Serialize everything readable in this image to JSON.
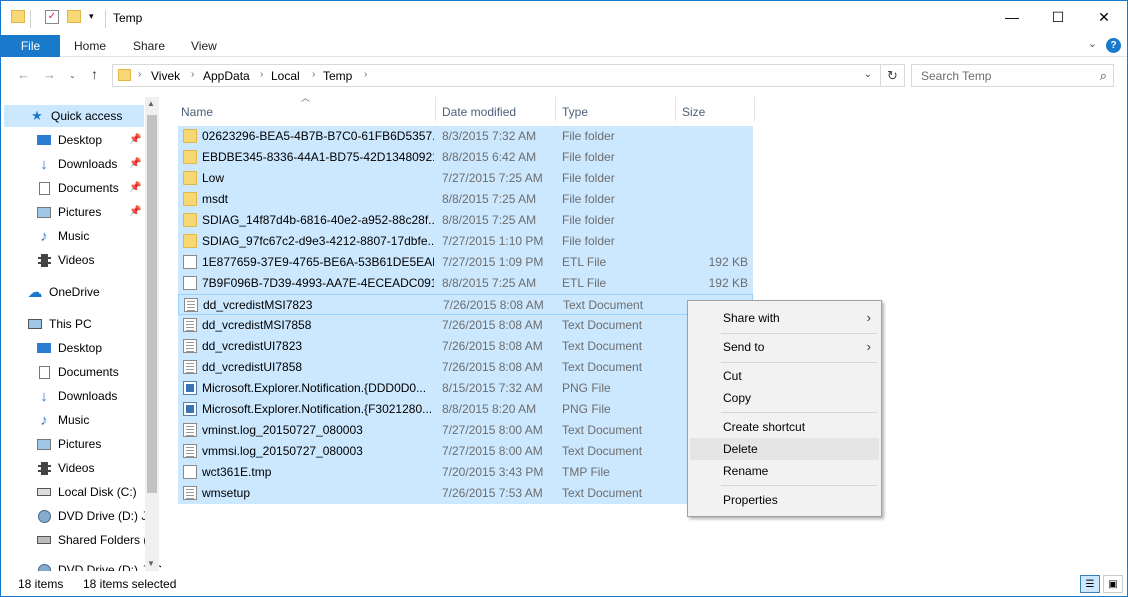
{
  "window": {
    "title": "Temp",
    "controls": {
      "minimize": "—",
      "maximize": "☐",
      "close": "✕"
    }
  },
  "ribbon": {
    "file": "File",
    "tabs": [
      "Home",
      "Share",
      "View"
    ]
  },
  "address": {
    "crumbs": [
      "Vivek",
      "AppData",
      "Local",
      "Temp"
    ],
    "search_placeholder": "Search Temp"
  },
  "nav": {
    "quick_access": "Quick access",
    "quick_items": [
      "Desktop",
      "Downloads",
      "Documents",
      "Pictures",
      "Music",
      "Videos"
    ],
    "onedrive": "OneDrive",
    "this_pc": "This PC",
    "pc_items": [
      "Desktop",
      "Documents",
      "Downloads",
      "Music",
      "Pictures",
      "Videos",
      "Local Disk (C:)",
      "DVD Drive (D:) J_",
      "Shared Folders (\\",
      "DVD Drive (D:) J_C"
    ]
  },
  "columns": {
    "name": "Name",
    "date": "Date modified",
    "type": "Type",
    "size": "Size"
  },
  "files": [
    {
      "name": "02623296-BEA5-4B7B-B7C0-61FB6D5357...",
      "date": "8/3/2015 7:32 AM",
      "type": "File folder",
      "size": "",
      "icon": "folder"
    },
    {
      "name": "EBDBE345-8336-44A1-BD75-42D134809216",
      "date": "8/8/2015 6:42 AM",
      "type": "File folder",
      "size": "",
      "icon": "folder"
    },
    {
      "name": "Low",
      "date": "7/27/2015 7:25 AM",
      "type": "File folder",
      "size": "",
      "icon": "folder"
    },
    {
      "name": "msdt",
      "date": "8/8/2015 7:25 AM",
      "type": "File folder",
      "size": "",
      "icon": "folder"
    },
    {
      "name": "SDIAG_14f87d4b-6816-40e2-a952-88c28f...",
      "date": "8/8/2015 7:25 AM",
      "type": "File folder",
      "size": "",
      "icon": "folder"
    },
    {
      "name": "SDIAG_97fc67c2-d9e3-4212-8807-17dbfe...",
      "date": "7/27/2015 1:10 PM",
      "type": "File folder",
      "size": "",
      "icon": "folder"
    },
    {
      "name": "1E877659-37E9-4765-BE6A-53B61DE5EAB...",
      "date": "7/27/2015 1:09 PM",
      "type": "ETL File",
      "size": "192 KB",
      "icon": "file"
    },
    {
      "name": "7B9F096B-7D39-4993-AA7E-4ECEADC091...",
      "date": "8/8/2015 7:25 AM",
      "type": "ETL File",
      "size": "192 KB",
      "icon": "file"
    },
    {
      "name": "dd_vcredistMSI7823",
      "date": "7/26/2015 8:08 AM",
      "type": "Text Document",
      "size": "",
      "icon": "text"
    },
    {
      "name": "dd_vcredistMSI7858",
      "date": "7/26/2015 8:08 AM",
      "type": "Text Document",
      "size": "",
      "icon": "text"
    },
    {
      "name": "dd_vcredistUI7823",
      "date": "7/26/2015 8:08 AM",
      "type": "Text Document",
      "size": "",
      "icon": "text"
    },
    {
      "name": "dd_vcredistUI7858",
      "date": "7/26/2015 8:08 AM",
      "type": "Text Document",
      "size": "",
      "icon": "text"
    },
    {
      "name": "Microsoft.Explorer.Notification.{DDD0D0...",
      "date": "8/15/2015 7:32 AM",
      "type": "PNG File",
      "size": "",
      "icon": "png"
    },
    {
      "name": "Microsoft.Explorer.Notification.{F3021280...",
      "date": "8/8/2015 8:20 AM",
      "type": "PNG File",
      "size": "",
      "icon": "png"
    },
    {
      "name": "vminst.log_20150727_080003",
      "date": "7/27/2015 8:00 AM",
      "type": "Text Document",
      "size": "",
      "icon": "text"
    },
    {
      "name": "vmmsi.log_20150727_080003",
      "date": "7/27/2015 8:00 AM",
      "type": "Text Document",
      "size": "",
      "icon": "text"
    },
    {
      "name": "wct361E.tmp",
      "date": "7/20/2015 3:43 PM",
      "type": "TMP File",
      "size": "",
      "icon": "file"
    },
    {
      "name": "wmsetup",
      "date": "7/26/2015 7:53 AM",
      "type": "Text Document",
      "size": "",
      "icon": "text"
    }
  ],
  "context_menu": {
    "share_with": "Share with",
    "send_to": "Send to",
    "cut": "Cut",
    "copy": "Copy",
    "create_shortcut": "Create shortcut",
    "delete": "Delete",
    "rename": "Rename",
    "properties": "Properties"
  },
  "status": {
    "count": "18 items",
    "selected": "18 items selected"
  },
  "colors": {
    "accent": "#1979ca",
    "selection": "#cce8ff",
    "folder": "#f8d775"
  }
}
